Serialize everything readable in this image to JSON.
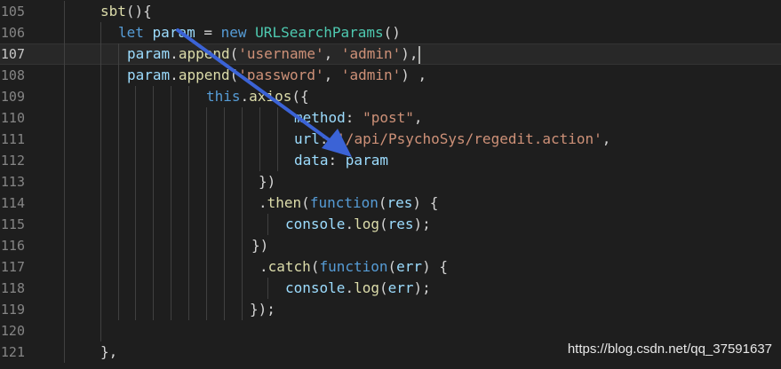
{
  "editor": {
    "current_line": "107",
    "lines": [
      {
        "num": "105",
        "tokens": [
          {
            "t": "sbt",
            "c": "fn"
          },
          {
            "t": "(){",
            "c": "pun"
          }
        ]
      },
      {
        "num": "106",
        "tokens": [
          {
            "t": "let",
            "c": "kw"
          },
          {
            "t": " ",
            "c": "pun"
          },
          {
            "t": "param",
            "c": "var"
          },
          {
            "t": " = ",
            "c": "pun"
          },
          {
            "t": "new",
            "c": "kw"
          },
          {
            "t": " ",
            "c": "pun"
          },
          {
            "t": "URLSearchParams",
            "c": "cls"
          },
          {
            "t": "()",
            "c": "pun"
          }
        ]
      },
      {
        "num": "107",
        "tokens": [
          {
            "t": "param",
            "c": "var"
          },
          {
            "t": ".",
            "c": "pun"
          },
          {
            "t": "append",
            "c": "fn"
          },
          {
            "t": "(",
            "c": "pun"
          },
          {
            "t": "'username'",
            "c": "str"
          },
          {
            "t": ", ",
            "c": "pun"
          },
          {
            "t": "'admin'",
            "c": "str"
          },
          {
            "t": "),",
            "c": "pun"
          }
        ]
      },
      {
        "num": "108",
        "tokens": [
          {
            "t": "param",
            "c": "var"
          },
          {
            "t": ".",
            "c": "pun"
          },
          {
            "t": "append",
            "c": "fn"
          },
          {
            "t": "(",
            "c": "pun"
          },
          {
            "t": "'password'",
            "c": "str"
          },
          {
            "t": ", ",
            "c": "pun"
          },
          {
            "t": "'admin'",
            "c": "str"
          },
          {
            "t": ") ,",
            "c": "pun"
          }
        ]
      },
      {
        "num": "109",
        "tokens": [
          {
            "t": "this",
            "c": "kw"
          },
          {
            "t": ".",
            "c": "pun"
          },
          {
            "t": "axios",
            "c": "fn"
          },
          {
            "t": "({",
            "c": "pun"
          }
        ]
      },
      {
        "num": "110",
        "tokens": [
          {
            "t": "method",
            "c": "var"
          },
          {
            "t": ": ",
            "c": "pun"
          },
          {
            "t": "\"post\"",
            "c": "str"
          },
          {
            "t": ",",
            "c": "pun"
          }
        ]
      },
      {
        "num": "111",
        "tokens": [
          {
            "t": "url",
            "c": "var"
          },
          {
            "t": ": ",
            "c": "pun"
          },
          {
            "t": "'/api/PsychoSys/regedit.action'",
            "c": "str"
          },
          {
            "t": ",",
            "c": "pun"
          }
        ]
      },
      {
        "num": "112",
        "tokens": [
          {
            "t": "data",
            "c": "var"
          },
          {
            "t": ": ",
            "c": "pun"
          },
          {
            "t": "param",
            "c": "var"
          }
        ]
      },
      {
        "num": "113",
        "tokens": [
          {
            "t": "})",
            "c": "pun"
          }
        ]
      },
      {
        "num": "114",
        "tokens": [
          {
            "t": ".",
            "c": "pun"
          },
          {
            "t": "then",
            "c": "fn"
          },
          {
            "t": "(",
            "c": "pun"
          },
          {
            "t": "function",
            "c": "kw"
          },
          {
            "t": "(",
            "c": "pun"
          },
          {
            "t": "res",
            "c": "var"
          },
          {
            "t": ") {",
            "c": "pun"
          }
        ]
      },
      {
        "num": "115",
        "tokens": [
          {
            "t": "console",
            "c": "var"
          },
          {
            "t": ".",
            "c": "pun"
          },
          {
            "t": "log",
            "c": "fn"
          },
          {
            "t": "(",
            "c": "pun"
          },
          {
            "t": "res",
            "c": "var"
          },
          {
            "t": ");",
            "c": "pun"
          }
        ]
      },
      {
        "num": "116",
        "tokens": [
          {
            "t": "})",
            "c": "pun"
          }
        ]
      },
      {
        "num": "117",
        "tokens": [
          {
            "t": ".",
            "c": "pun"
          },
          {
            "t": "catch",
            "c": "fn"
          },
          {
            "t": "(",
            "c": "pun"
          },
          {
            "t": "function",
            "c": "kw"
          },
          {
            "t": "(",
            "c": "pun"
          },
          {
            "t": "err",
            "c": "var"
          },
          {
            "t": ") {",
            "c": "pun"
          }
        ]
      },
      {
        "num": "118",
        "tokens": [
          {
            "t": "console",
            "c": "var"
          },
          {
            "t": ".",
            "c": "pun"
          },
          {
            "t": "log",
            "c": "fn"
          },
          {
            "t": "(",
            "c": "pun"
          },
          {
            "t": "err",
            "c": "var"
          },
          {
            "t": ");",
            "c": "pun"
          }
        ]
      },
      {
        "num": "119",
        "tokens": [
          {
            "t": "});",
            "c": "pun"
          }
        ]
      },
      {
        "num": "120",
        "tokens": []
      },
      {
        "num": "121",
        "tokens": [
          {
            "t": "},",
            "c": "pun"
          }
        ]
      }
    ]
  },
  "watermark": "https://blog.csdn.net/qq_37591637",
  "colors": {
    "background": "#1e1e1e",
    "keyword": "#569cd6",
    "function": "#dcdcaa",
    "variable": "#9cdcfe",
    "class": "#4ec9b0",
    "string": "#ce9178",
    "arrow": "#3b63d6"
  }
}
